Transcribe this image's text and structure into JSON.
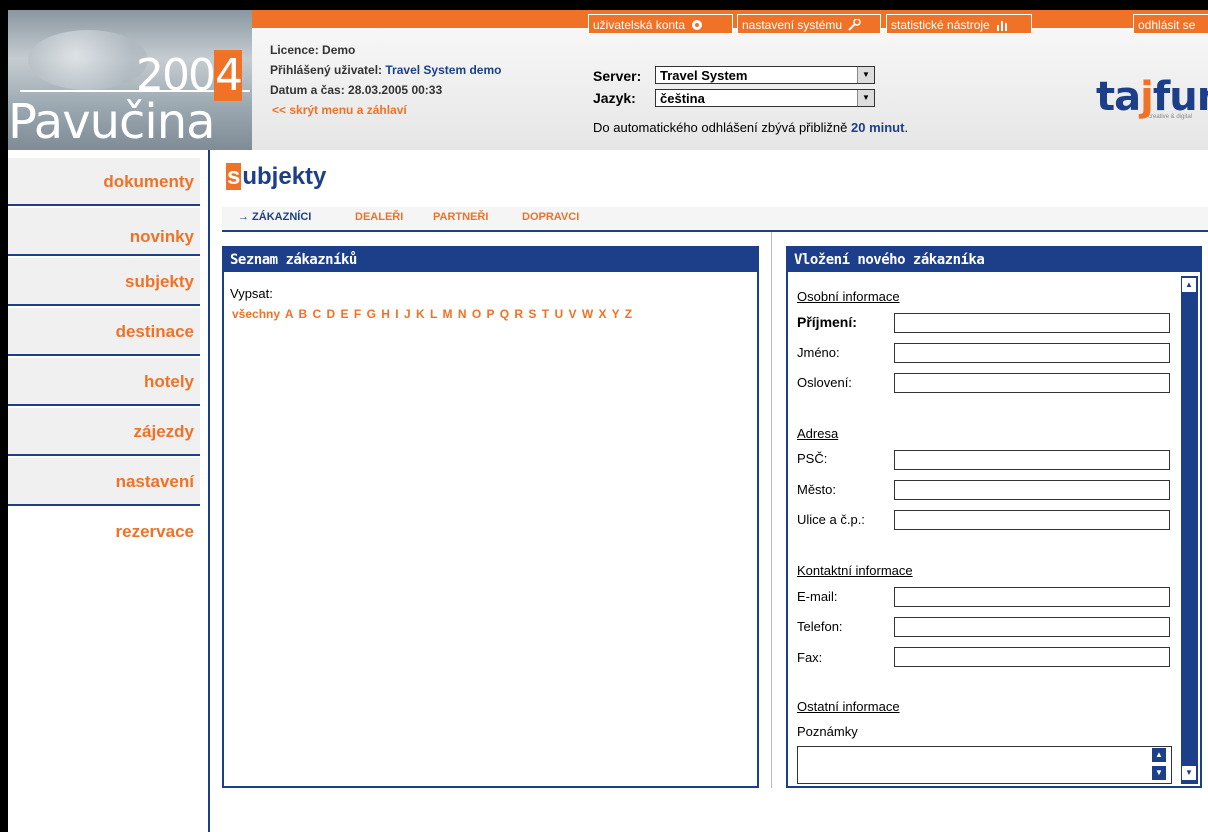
{
  "logo": {
    "year_main": "200",
    "year_last": "4",
    "name": "Pavučina"
  },
  "header": {
    "licence_label": "Licence:",
    "licence_value": "Demo",
    "user_label": "Přihlášený uživatel:",
    "user_value": "Travel System demo",
    "datetime_label": "Datum a čas:",
    "datetime_value": "28.03.2005 00:33",
    "hide_link": "<< skrýt menu a záhlaví"
  },
  "top_menu": [
    {
      "label": "uživatelská konta",
      "icon": "users-icon"
    },
    {
      "label": "nastavení systému",
      "icon": "wrench-icon"
    },
    {
      "label": "statistické nástroje",
      "icon": "bar-chart-icon"
    },
    {
      "label": "odhlásit se",
      "icon": ""
    }
  ],
  "server": {
    "label": "Server:",
    "value": "Travel System"
  },
  "language": {
    "label": "Jazyk:",
    "value": "čeština"
  },
  "autologout": {
    "prefix": "Do automatického odhlášení zbývá přibližně",
    "value": "20 minut",
    "suffix": "."
  },
  "brand": {
    "name_left": "ta",
    "name_mid": "j",
    "name_right": "fun",
    "tagline": "creative & digital"
  },
  "sidebar": {
    "items": [
      "dokumenty",
      "novinky",
      "subjekty",
      "destinace",
      "hotely",
      "zájezdy",
      "nastavení",
      "rezervace"
    ]
  },
  "page": {
    "title_first": "s",
    "title_rest": "ubjekty"
  },
  "tabs": [
    {
      "label": "→ ZÁKAZNÍCI",
      "active": true
    },
    {
      "label": "DEALEŘI",
      "active": false
    },
    {
      "label": "PARTNEŘI",
      "active": false
    },
    {
      "label": "DOPRAVCI",
      "active": false
    }
  ],
  "list_panel": {
    "title": "Seznam zákazníků",
    "list_label": "Vypsat:",
    "letters": [
      "všechny",
      "A",
      "B",
      "C",
      "D",
      "E",
      "F",
      "G",
      "H",
      "I",
      "J",
      "K",
      "L",
      "M",
      "N",
      "O",
      "P",
      "Q",
      "R",
      "S",
      "T",
      "U",
      "V",
      "W",
      "X",
      "Y",
      "Z"
    ]
  },
  "form_panel": {
    "title": "Vložení nového zákazníka",
    "section_personal": "Osobní informace",
    "surname": "Příjmení:",
    "firstname": "Jméno:",
    "salutation": "Oslovení:",
    "section_address": "Adresa",
    "zip": "PSČ:",
    "city": "Město:",
    "street": "Ulice a č.p.:",
    "section_contact": "Kontaktní informace",
    "email": "E-mail:",
    "phone": "Telefon:",
    "fax": "Fax:",
    "section_other": "Ostatní informace",
    "notes": "Poznámky"
  },
  "colors": {
    "accent": "#f07227",
    "brand": "#1d3f8a"
  }
}
